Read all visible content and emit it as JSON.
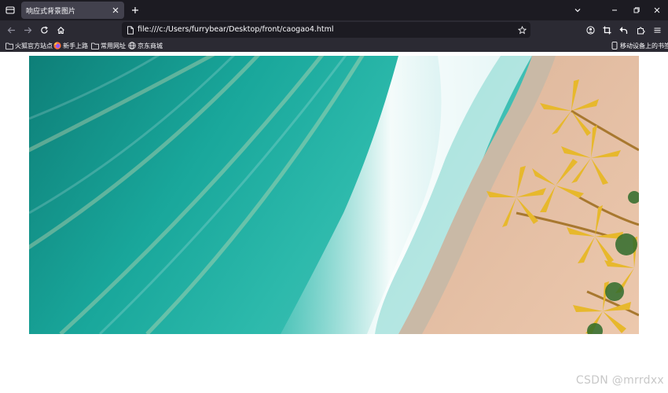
{
  "browser": {
    "tab": {
      "title": "响应式背景图片"
    },
    "address_bar": {
      "url": "file:///c:/Users/furrybear/Desktop/front/caogao4.html"
    },
    "bookmarks": [
      {
        "label": "火狐官方站点",
        "icon": "folder-icon"
      },
      {
        "label": "新手上路",
        "icon": "firefox-icon"
      },
      {
        "label": "常用网址",
        "icon": "folder-icon"
      },
      {
        "label": "京东商城",
        "icon": "globe-icon"
      }
    ],
    "mobile_bookmarks": {
      "label": "移动设备上的书签",
      "icon": "mobile-icon"
    }
  },
  "page": {
    "hero_image": {
      "subject": "aerial beach with turquoise waves and palm trees"
    }
  },
  "watermark": "CSDN @mrrdxx",
  "colors": {
    "tabstrip_bg": "#1c1b22",
    "toolbar_bg": "#2b2a33",
    "active_tab_bg": "#42414d",
    "text": "#fbfbfe",
    "sea": "#1aa49a",
    "sand": "#e6bf9f"
  }
}
